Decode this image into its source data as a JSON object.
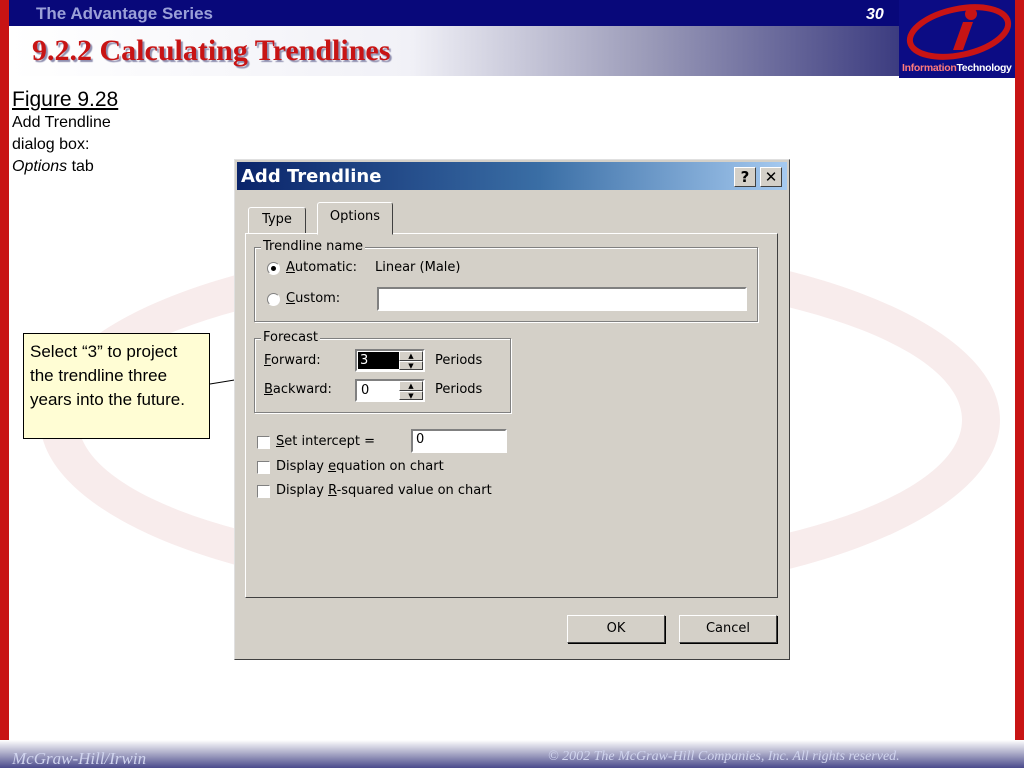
{
  "slide": {
    "series": "The Advantage Series",
    "page_number": "30",
    "title": "9.2.2 Calculating Trendlines",
    "logo_word_information": "Information",
    "logo_word_technology": "Technology",
    "footer_left": "McGraw-Hill/Irwin",
    "footer_right": "© 2002  The McGraw-Hill Companies, Inc. All rights reserved.",
    "colors": {
      "frame_red": "#c81414",
      "band_navy": "#08087a"
    }
  },
  "caption": {
    "figure": "Figure 9.28",
    "line1": "Add Trendline",
    "line2": "dialog box:",
    "line3_italic": "Options",
    "line3_rest": " tab"
  },
  "callout": {
    "text": "Select “3” to project the trendline three years into the future."
  },
  "dialog": {
    "title": "Add Trendline",
    "help_button": "?",
    "close_button": "✕",
    "tabs": {
      "type": "Type",
      "options": "Options",
      "active": "Options"
    },
    "trendline_name": {
      "group_label": "Trendline name",
      "automatic_key": "A",
      "automatic_rest": "utomatic:",
      "automatic_value": "Linear (Male)",
      "automatic_selected": true,
      "custom_key": "C",
      "custom_rest": "ustom:",
      "custom_value": ""
    },
    "forecast": {
      "group_label": "Forecast",
      "forward_key": "F",
      "forward_rest": "orward:",
      "forward_value": "3",
      "forward_unit": "Periods",
      "backward_key": "B",
      "backward_rest": "ackward:",
      "backward_value": "0",
      "backward_unit": "Periods"
    },
    "set_intercept": {
      "key": "S",
      "rest": "et intercept =",
      "value": "0",
      "checked": false
    },
    "display_equation": {
      "before": "Display ",
      "key": "e",
      "rest": "quation on chart",
      "checked": false
    },
    "display_rsquared": {
      "before": "Display ",
      "key": "R",
      "rest": "-squared value on chart",
      "checked": false
    },
    "ok_button": "OK",
    "cancel_button": "Cancel"
  }
}
